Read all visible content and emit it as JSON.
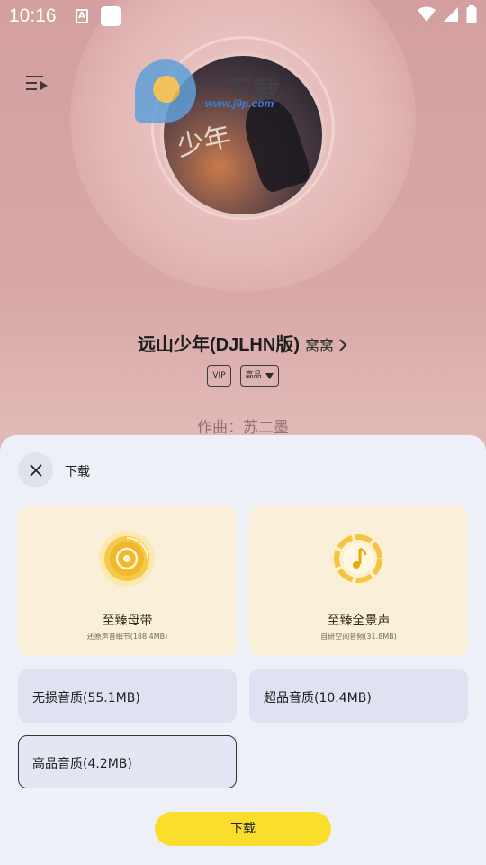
{
  "status_bar": {
    "time": "10:16",
    "a_badge": "A"
  },
  "watermark": {
    "url": "www.j9p.com",
    "brand": "下载"
  },
  "album": {
    "script_text": "少年"
  },
  "song": {
    "title": "远山少年(DJLHN版)",
    "artist": "窝窝",
    "tags": {
      "vip": "VIP",
      "quality": "高品"
    },
    "composer": "作曲：苏二墨"
  },
  "sheet": {
    "title": "下载",
    "premium_options": [
      {
        "title": "至臻母带",
        "subtitle": "还原声音细节(188.4MB)",
        "icon": "master-tape-disc-icon"
      },
      {
        "title": "至臻全景声",
        "subtitle": "自研空间音频(31.8MB)",
        "icon": "surround-music-note-icon"
      }
    ],
    "options": [
      {
        "label": "无损音质(55.1MB)"
      },
      {
        "label": "超品音质(10.4MB)"
      },
      {
        "label": "高品音质(4.2MB)"
      }
    ],
    "download_label": "下载"
  },
  "colors": {
    "accent_yellow": "#fbde2c",
    "premium_card_bg": "#faefd8",
    "option_card_bg": "#dfe2f0",
    "sheet_bg": "#eef0f8"
  }
}
